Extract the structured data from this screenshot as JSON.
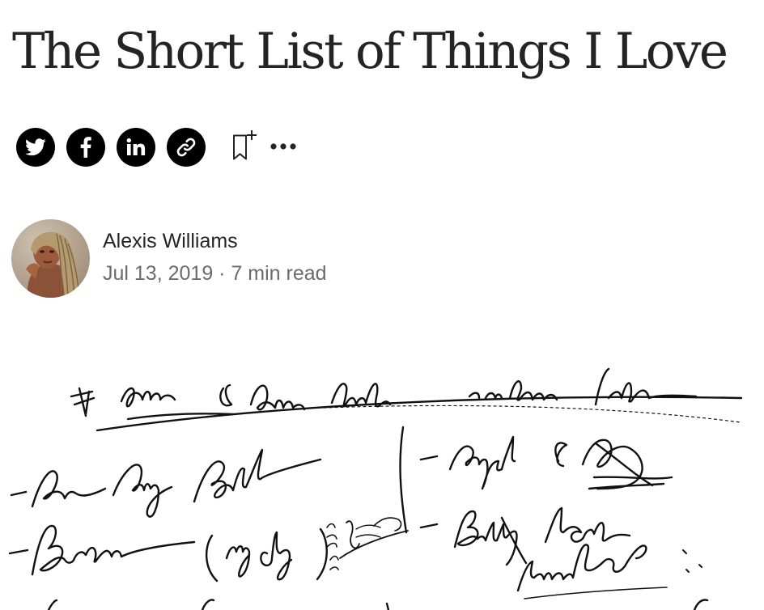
{
  "article": {
    "title": "The Short List of Things I Love"
  },
  "share": {
    "twitter_icon": "twitter-icon",
    "facebook_icon": "facebook-icon",
    "linkedin_icon": "linkedin-icon",
    "link_icon": "link-icon",
    "bookmark_icon": "bookmark-add-icon",
    "more_icon": "more-horizontal-icon"
  },
  "author": {
    "name": "Alexis Williams",
    "date": "Jul 13, 2019",
    "separator": " · ",
    "read_time": "7 min read"
  },
  "colors": {
    "text": "#242424",
    "muted": "#6b6b6b",
    "icon_bg": "#000000"
  }
}
